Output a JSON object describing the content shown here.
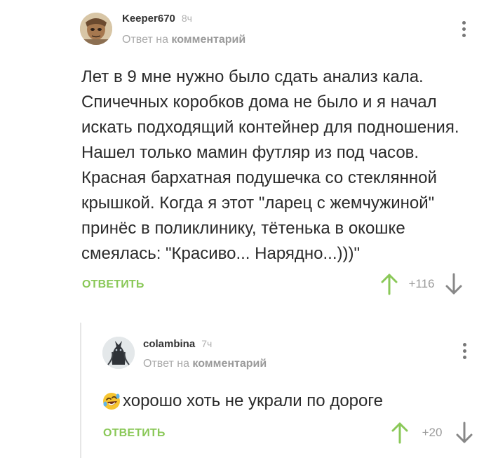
{
  "colors": {
    "accent_green": "#8ac858",
    "muted_text": "#a9a9a9",
    "icon_gray": "#777777"
  },
  "comments": [
    {
      "author": "Keeper670",
      "time": "8ч",
      "reply_prefix": "Ответ на",
      "reply_target": "комментарий",
      "text": "Лет в 9 мне нужно было сдать анализ кала. Спичечных коробков дома не было и я начал искать подходящий контейнер для подношения. Нашел только мамин футляр из под часов. Красная бархатная подушечка со стеклянной крышкой. Когда я этот \"ларец с жемчужиной\" принёс в поликлинику, тётенька в окошке смеялась: \"Красиво... Нарядно...)))\"",
      "reply_label": "ОТВЕТИТЬ",
      "rating": "+116",
      "avatar_icon": "avatar-portrait-icon"
    },
    {
      "author": "colambina",
      "time": "7ч",
      "reply_prefix": "Ответ на",
      "reply_target": "комментарий",
      "emoji_icon": "rolling-laughing-emoji-icon",
      "text": "хорошо хоть не украли по дороге",
      "reply_label": "ОТВЕТИТЬ",
      "rating": "+20",
      "avatar_icon": "avatar-dark-figure-icon"
    }
  ]
}
